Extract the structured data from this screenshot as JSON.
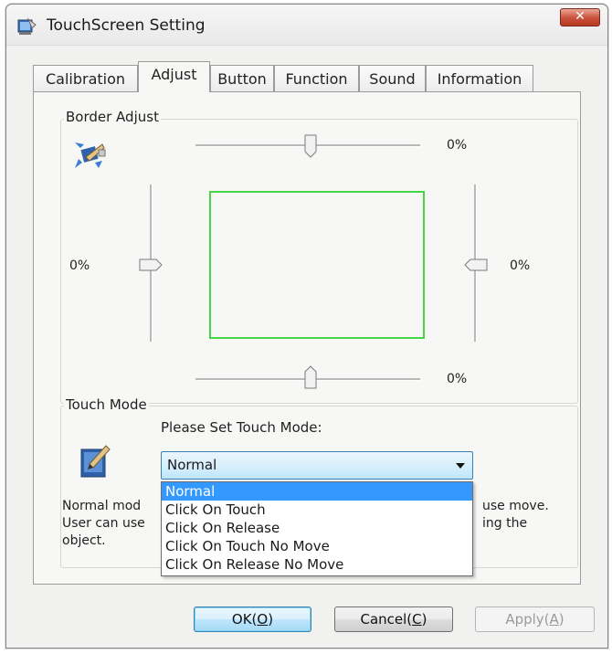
{
  "window": {
    "title": "TouchScreen Setting",
    "close_glyph": "✕",
    "icon": "touchscreen-app-icon"
  },
  "tabs": [
    {
      "label": "Calibration",
      "active": false
    },
    {
      "label": "Adjust",
      "active": true
    },
    {
      "label": "Button",
      "active": false
    },
    {
      "label": "Function",
      "active": false
    },
    {
      "label": "Sound",
      "active": false
    },
    {
      "label": "Information",
      "active": false
    }
  ],
  "border_adjust": {
    "legend": "Border Adjust",
    "icon": "border-adjust-icon",
    "top_value": "0%",
    "left_value": "0%",
    "right_value": "0%",
    "bottom_value": "0%",
    "preview_border_color": "#44d444"
  },
  "touch_mode": {
    "legend": "Touch Mode",
    "icon": "touch-mode-icon",
    "prompt": "Please Set Touch Mode:",
    "selected": "Normal",
    "options": [
      "Normal",
      "Click On Touch",
      "Click On Release",
      "Click On Touch No Move",
      "Click On Release No Move"
    ],
    "description_left": [
      "Normal mod",
      "User can use",
      "object."
    ],
    "description_right": [
      "use move.",
      "ing the"
    ]
  },
  "buttons": {
    "ok": {
      "pre": "OK(",
      "key": "O",
      "post": ")"
    },
    "cancel": {
      "pre": "Cancel(",
      "key": "C",
      "post": ")"
    },
    "apply": {
      "pre": "Apply(",
      "key": "A",
      "post": ")"
    }
  },
  "colors": {
    "selection": "#3399ff",
    "accent": "#3c7fb1",
    "close": "#c8503a"
  }
}
